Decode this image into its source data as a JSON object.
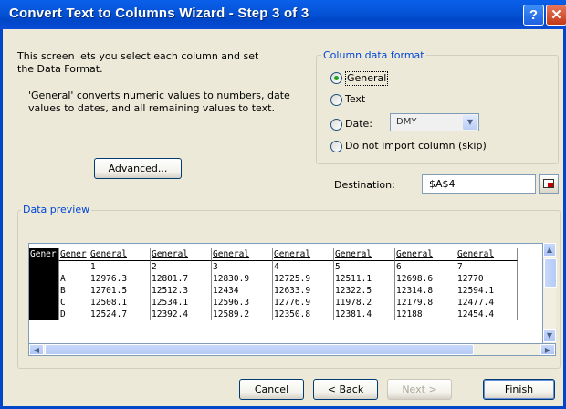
{
  "window": {
    "title": "Convert Text to Columns Wizard - Step 3 of 3"
  },
  "intro": {
    "line1": "This screen lets you select each column and set",
    "line2": "the Data Format.",
    "desc1": "'General' converts numeric values to numbers, date",
    "desc2": "values to dates, and all remaining values to text."
  },
  "advanced_button": "Advanced...",
  "format": {
    "title": "Column data format",
    "general": "General",
    "text": "Text",
    "date": "Date:",
    "date_value": "DMY",
    "skip": "Do not import column (skip)",
    "selected": "General"
  },
  "destination": {
    "label": "Destination:",
    "value": "$A$4"
  },
  "preview": {
    "title": "Data preview",
    "headers": [
      "Gener",
      "Gener",
      "General",
      "General",
      "General",
      "General",
      "General",
      "General",
      "General"
    ],
    "rows": [
      [
        "",
        "",
        "1",
        "2",
        "3",
        "4",
        "5",
        "6",
        "7"
      ],
      [
        "",
        "A",
        "12976.3",
        "12801.7",
        "12830.9",
        "12725.9",
        "12511.1",
        "12698.6",
        "12770"
      ],
      [
        "",
        "B",
        "12701.5",
        "12512.3",
        "12434",
        "12633.9",
        "12322.5",
        "12314.8",
        "12594.1"
      ],
      [
        "",
        "C",
        "12508.1",
        "12534.1",
        "12596.3",
        "12776.9",
        "11978.2",
        "12179.8",
        "12477.4"
      ],
      [
        "",
        "D",
        "12524.7",
        "12392.4",
        "12589.2",
        "12350.8",
        "12381.4",
        "12188",
        "12454.4"
      ]
    ]
  },
  "buttons": {
    "cancel": "Cancel",
    "back": "< Back",
    "next": "Next >",
    "finish": "Finish"
  }
}
